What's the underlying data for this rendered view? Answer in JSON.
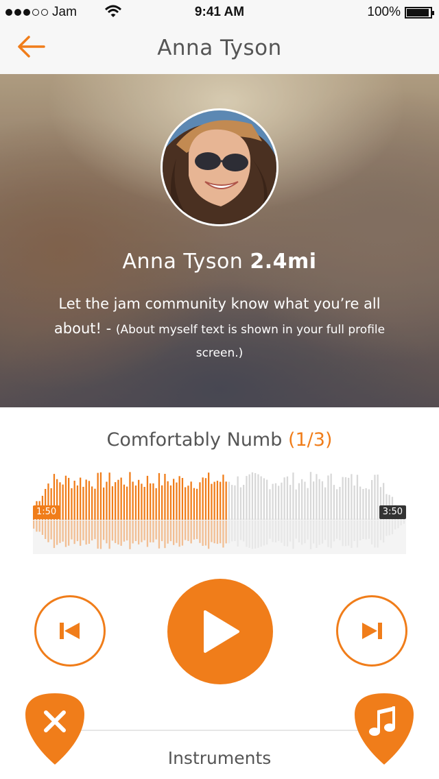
{
  "status_bar": {
    "carrier": "Jam",
    "time": "9:41 AM",
    "battery": "100%",
    "battery_level": 1.0,
    "signal_bars_filled": 3,
    "signal_bars_total": 5
  },
  "nav": {
    "title": "Anna Tyson",
    "back_icon": "arrow-left-icon"
  },
  "profile": {
    "name": "Anna Tyson",
    "distance": "2.4mi",
    "about_main": "Let the jam community know what you’re all about! - ",
    "about_note": "(About myself text is shown in your full profile screen.)"
  },
  "song": {
    "title": "Comfortably Numb",
    "count": "(1/3)",
    "elapsed": "1:50",
    "total": "3:50",
    "progress": 0.52
  },
  "controls": {
    "prev_icon": "skip-back-icon",
    "play_icon": "play-icon",
    "next_icon": "skip-forward-icon"
  },
  "bottom": {
    "label": "Instruments",
    "left_icon": "close-icon",
    "right_icon": "music-note-icon"
  },
  "colors": {
    "accent": "#f07d1a",
    "waveform_inactive": "#d8d8d8",
    "text": "#555555"
  }
}
